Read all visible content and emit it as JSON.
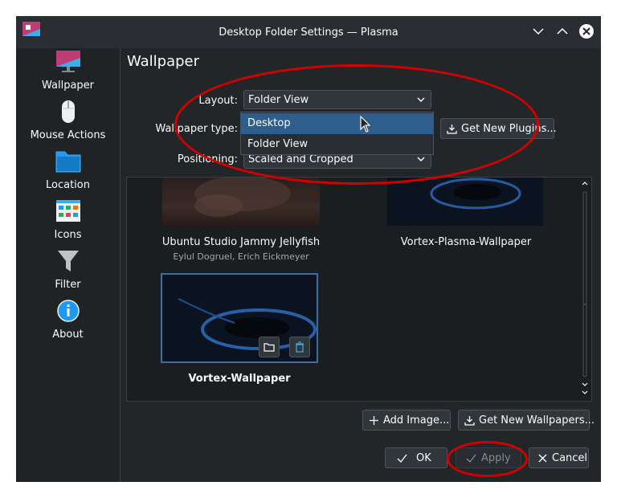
{
  "window": {
    "title": "Desktop Folder Settings — Plasma",
    "controls": [
      "minimize-icon",
      "maximize-icon",
      "close-icon"
    ]
  },
  "sidebar": {
    "items": [
      {
        "label": "Wallpaper",
        "icon": "monitor-icon"
      },
      {
        "label": "Mouse Actions",
        "icon": "mouse-icon"
      },
      {
        "label": "Location",
        "icon": "folder-icon"
      },
      {
        "label": "Icons",
        "icon": "icons-grid-icon"
      },
      {
        "label": "Filter",
        "icon": "filter-icon"
      },
      {
        "label": "About",
        "icon": "info-icon"
      }
    ]
  },
  "page": {
    "heading": "Wallpaper",
    "layout_label": "Layout:",
    "layout_value": "Folder View",
    "wallpaper_type_label": "Wallpaper type:",
    "get_new_plugins": "Get New Plugins...",
    "positioning_label": "Positioning:",
    "positioning_value": "Scaled and Cropped"
  },
  "dropdown": {
    "options": [
      "Desktop",
      "Folder View"
    ],
    "highlighted": "Desktop"
  },
  "wallpapers": [
    {
      "name": "Ubuntu Studio Jammy Jellyfish",
      "author": "Eylul Dogruel, Erich Eickmeyer"
    },
    {
      "name": "Vortex-Plasma-Wallpaper",
      "author": ""
    },
    {
      "name": "Vortex-Wallpaper",
      "author": "",
      "selected": true
    }
  ],
  "actions": {
    "add_image": "Add Image...",
    "get_new_wallpapers": "Get New Wallpapers..."
  },
  "footer": {
    "ok": "OK",
    "apply": "Apply",
    "cancel": "Cancel"
  },
  "colors": {
    "background": "#232629",
    "accent": "#3daee9",
    "highlight": "#2e5e8c",
    "annotation": "#d40000"
  }
}
